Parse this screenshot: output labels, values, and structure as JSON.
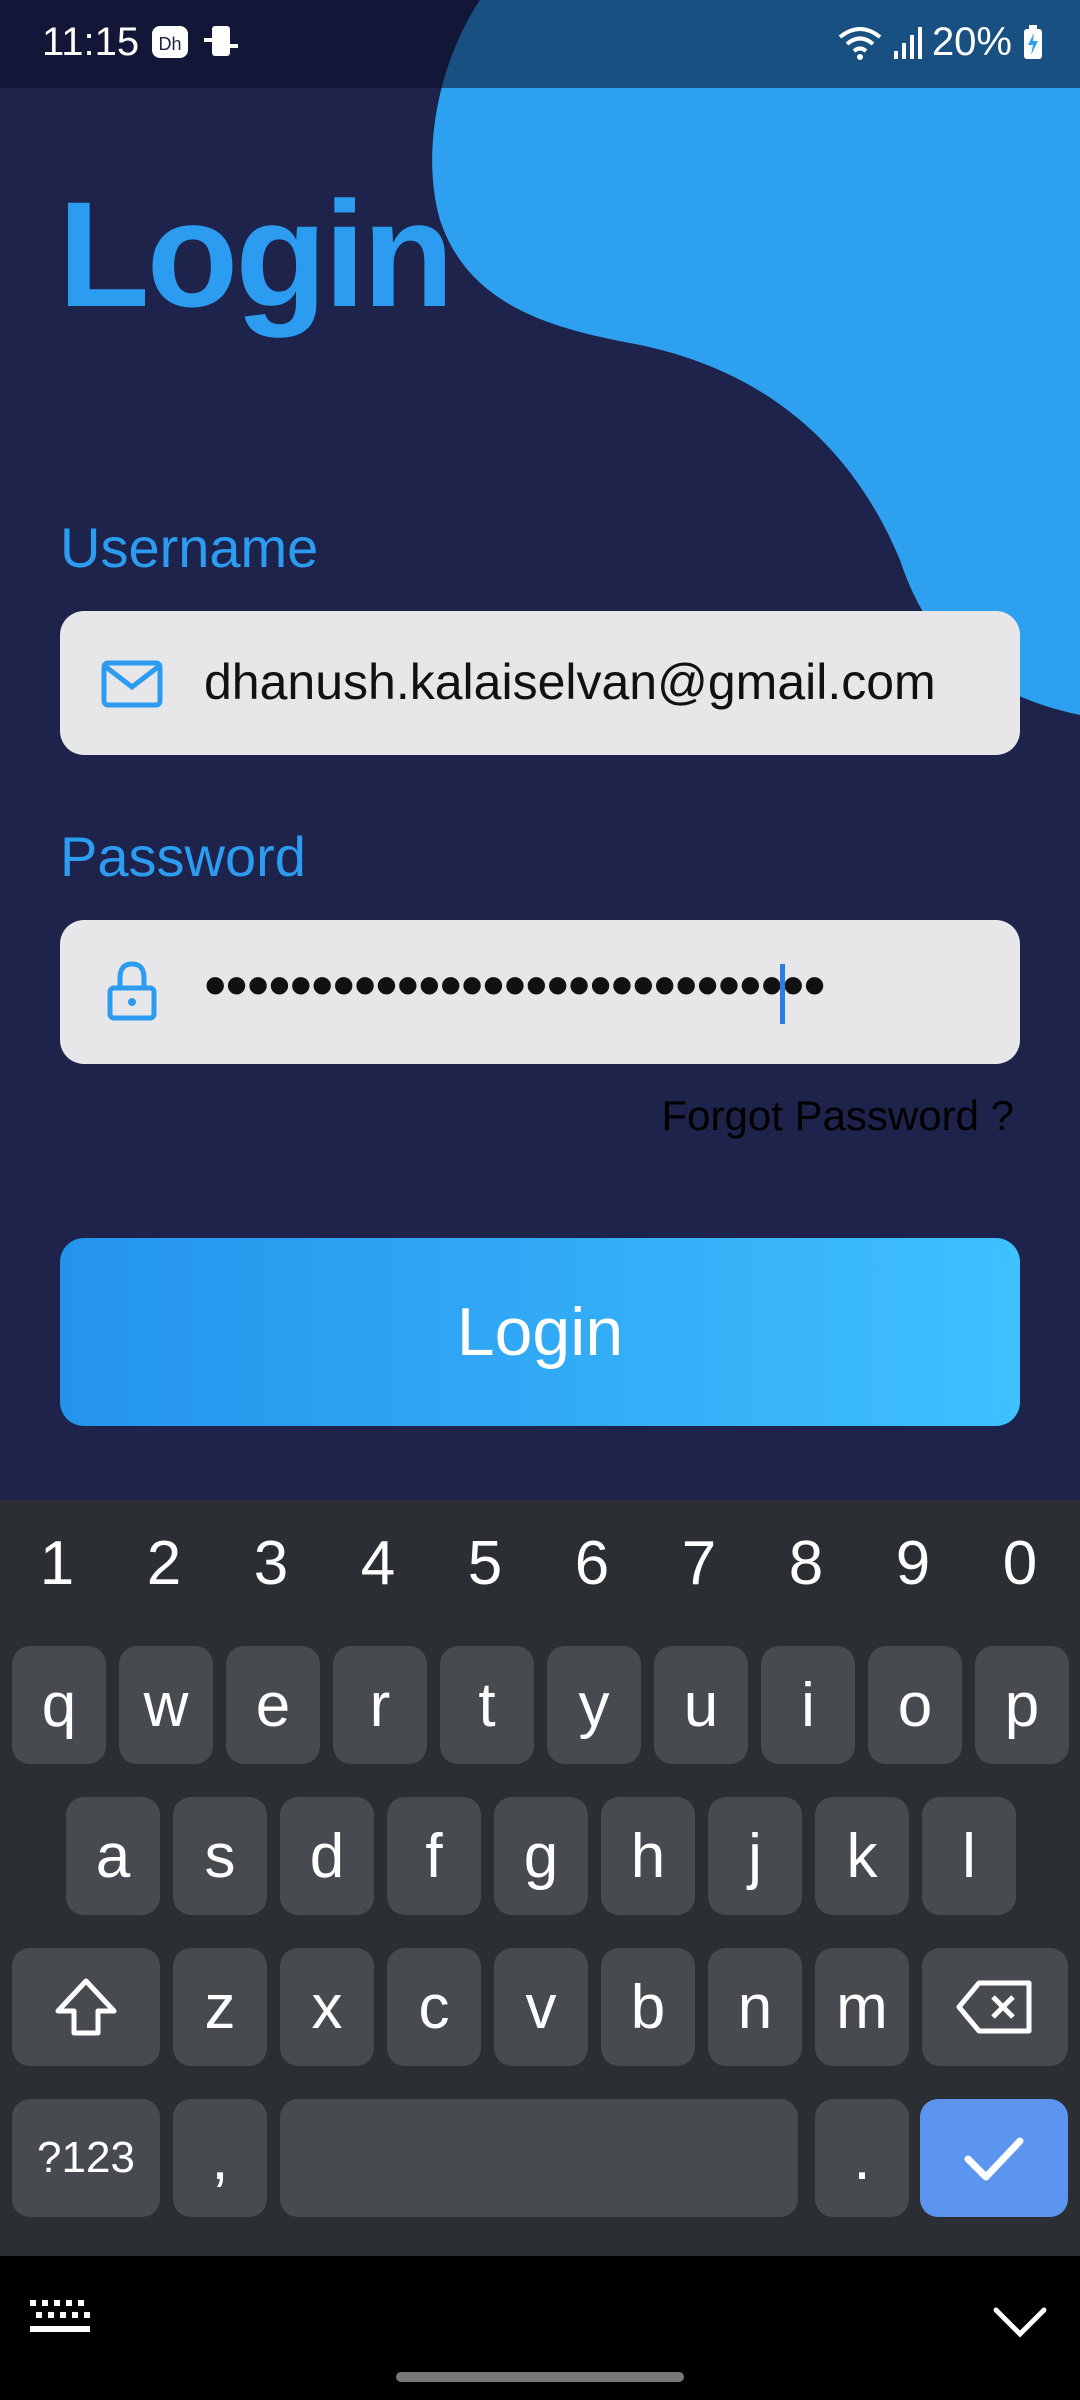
{
  "status_bar": {
    "time": "11:15",
    "battery": "20%",
    "icons": [
      "dh-notification-icon",
      "device-sync-icon",
      "wifi-icon",
      "signal-icon",
      "battery-charging-icon"
    ]
  },
  "app": {
    "title": "Login",
    "username_label": "Username",
    "username_value": "dhanush.kalaiselvan@gmail.com",
    "username_icon": "mail-icon",
    "password_label": "Password",
    "password_masked": "•••••••••••••••••••••••••••••",
    "password_icon": "lock-icon",
    "forgot_password": "Forgot Password ?",
    "login_button": "Login",
    "colors": {
      "background": "#1e234b",
      "accent": "#2b9cf0",
      "blob": "#2ea0f0",
      "field": "#e7e7e9",
      "button_start": "#2493ec",
      "button_end": "#3fc0ff"
    }
  },
  "keyboard": {
    "numbers": [
      "1",
      "2",
      "3",
      "4",
      "5",
      "6",
      "7",
      "8",
      "9",
      "0"
    ],
    "row1": [
      "q",
      "w",
      "e",
      "r",
      "t",
      "y",
      "u",
      "i",
      "o",
      "p"
    ],
    "row2": [
      "a",
      "s",
      "d",
      "f",
      "g",
      "h",
      "j",
      "k",
      "l"
    ],
    "row3": [
      "z",
      "x",
      "c",
      "v",
      "b",
      "n",
      "m"
    ],
    "symbols": "?123",
    "comma": ",",
    "period": ".",
    "icons": [
      "shift-icon",
      "backspace-icon",
      "checkmark-icon",
      "keyboard-icon",
      "chevron-down-icon"
    ]
  }
}
